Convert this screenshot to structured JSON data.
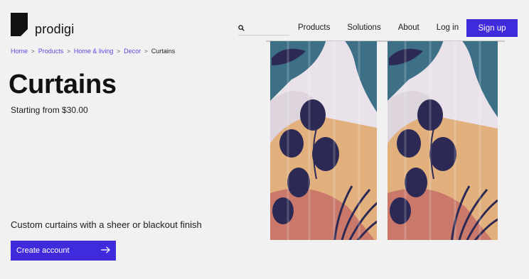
{
  "brand": {
    "name": "prodigi"
  },
  "search": {
    "placeholder": ""
  },
  "nav": {
    "items": [
      {
        "label": "Products"
      },
      {
        "label": "Solutions"
      },
      {
        "label": "About"
      },
      {
        "label": "Log in"
      }
    ],
    "signup_label": "Sign up"
  },
  "breadcrumb": {
    "items": [
      {
        "label": "Home"
      },
      {
        "label": "Products"
      },
      {
        "label": "Home & living"
      },
      {
        "label": "Decor"
      }
    ],
    "current": "Curtains",
    "separator": ">"
  },
  "product": {
    "title": "Curtains",
    "price": "Starting from $30.00",
    "description": "Custom curtains with a sheer or blackout finish",
    "cta_label": "Create account"
  },
  "colors": {
    "accent": "#3f2bdb",
    "link": "#5a4ae0",
    "background": "#f1f1f1",
    "curtain_teal": "#3d6f86",
    "curtain_navy": "#2c2a55",
    "curtain_peach": "#e2b07d",
    "curtain_terracotta": "#c9786a",
    "curtain_lilac": "#ddd4de"
  }
}
